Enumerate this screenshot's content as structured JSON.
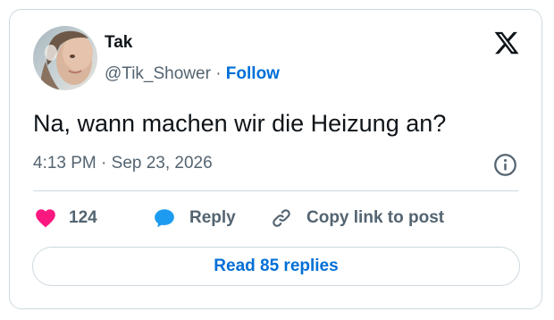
{
  "tweet": {
    "author_name": "Tak",
    "author_handle": "@Tik_Shower",
    "separator": "·",
    "follow_label": "Follow",
    "text": "Na, wann machen wir die Heizung an?",
    "timestamp": "4:13 PM · Sep 23, 2026"
  },
  "actions": {
    "like_count": "124",
    "reply_label": "Reply",
    "copy_link_label": "Copy link to post"
  },
  "footer": {
    "read_replies_label": "Read 85 replies"
  },
  "icons": {
    "brand": "x-logo-icon",
    "info": "info-icon",
    "like": "heart-icon",
    "reply": "speech-bubble-icon",
    "copy_link": "link-icon"
  },
  "colors": {
    "like": "#f91880",
    "reply": "#1d9bf0",
    "link_blue": "#006fd6",
    "text_primary": "#0f1419",
    "text_secondary": "#536471",
    "border": "#cfd9de"
  }
}
